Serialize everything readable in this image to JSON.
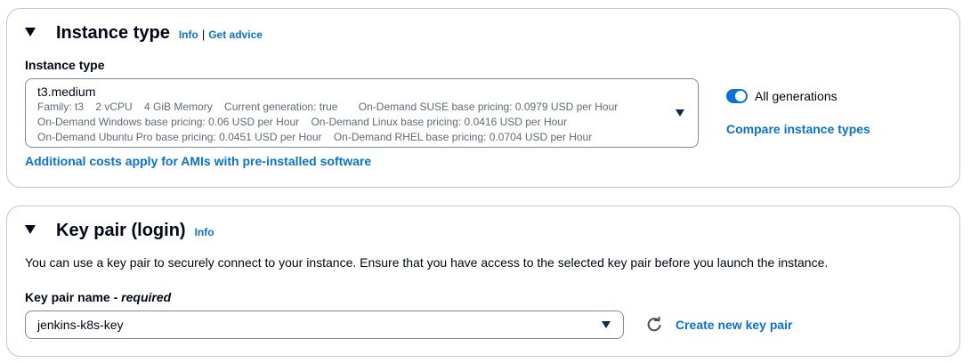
{
  "instance_type": {
    "heading": "Instance type",
    "info": "Info",
    "separator": "|",
    "get_advice": "Get advice",
    "field_label": "Instance type",
    "selected": {
      "name": "t3.medium",
      "line1": "Family: t3    2 vCPU    4 GiB Memory    Current generation: true       On-Demand SUSE base pricing: 0.0979 USD per Hour",
      "line2": "On-Demand Windows base pricing: 0.06 USD per Hour    On-Demand Linux base pricing: 0.0416 USD per Hour",
      "line3": "On-Demand Ubuntu Pro base pricing: 0.0451 USD per Hour    On-Demand RHEL base pricing: 0.0704 USD per Hour"
    },
    "all_generations_label": "All generations",
    "all_generations_on": true,
    "compare_link": "Compare instance types",
    "ami_costs_link": "Additional costs apply for AMIs with pre-installed software"
  },
  "key_pair": {
    "heading": "Key pair (login)",
    "info": "Info",
    "description": "You can use a key pair to securely connect to your instance. Ensure that you have access to the selected key pair before you launch the instance.",
    "field_label": "Key pair name - ",
    "field_required": "required",
    "selected": "jenkins-k8s-key",
    "create_link": "Create new key pair"
  },
  "colors": {
    "link": "#0972d3",
    "text": "#000716",
    "secondary_text": "#5f6b7a",
    "border": "#c6c6cd"
  }
}
